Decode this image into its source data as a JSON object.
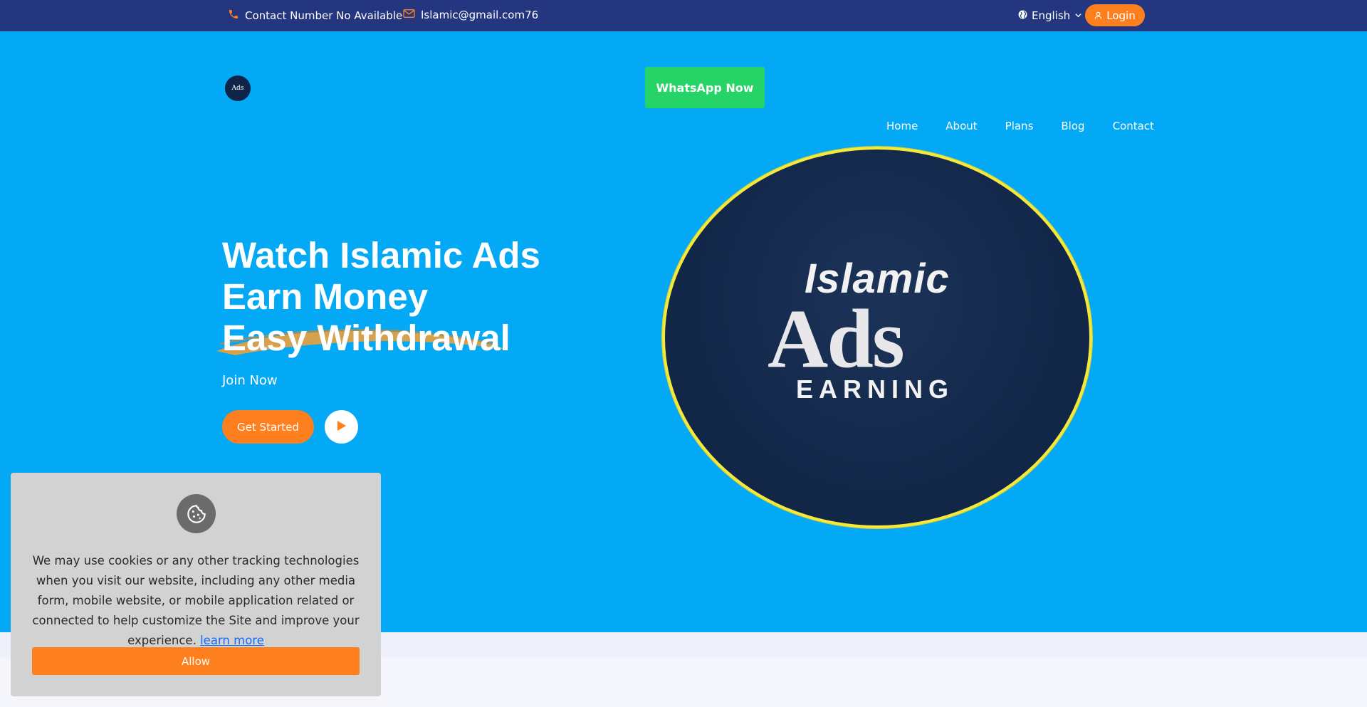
{
  "topbar": {
    "contact_text": "Contact Number No Available",
    "email_text": "Islamic@gmail.com76",
    "language": "English",
    "login_label": "Login",
    "icons": {
      "phone": "phone-icon",
      "email": "envelope-icon",
      "globe": "globe-icon",
      "chevron": "chevron-down-icon",
      "user": "user-icon"
    }
  },
  "header": {
    "logo_text": "Ads",
    "whatsapp_label": "WhatsApp Now",
    "nav": [
      {
        "label": "Home"
      },
      {
        "label": "About"
      },
      {
        "label": "Plans"
      },
      {
        "label": "Blog"
      },
      {
        "label": "Contact"
      }
    ]
  },
  "hero": {
    "headline": [
      "Watch Islamic Ads",
      "Earn Money",
      "Easy Withdrawal"
    ],
    "subtitle": "Join Now",
    "cta_label": "Get Started",
    "logo": {
      "line1": "Islamic",
      "line2": "Ads",
      "line3": "EARNING"
    }
  },
  "cookie": {
    "text": "We may use cookies or any other tracking technologies when you visit our website, including any other media form, mobile website, or mobile application related or connected to help customize the Site and improve your experience.",
    "link_label": "learn more",
    "allow_label": "Allow"
  },
  "colors": {
    "topbar": "#23367f",
    "hero_bg": "#03a9f4",
    "accent_orange": "#fe7f1d",
    "whatsapp_green": "#25d366",
    "logo_ring": "#f5e93b"
  }
}
